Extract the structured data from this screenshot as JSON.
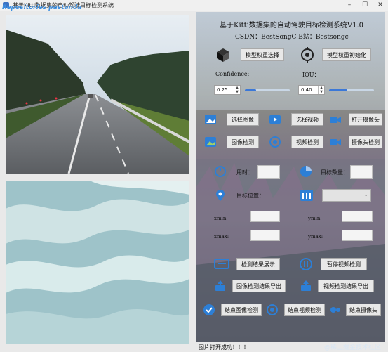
{
  "window": {
    "title": "基于Kitti数据集的自动驾驶目标检测系统",
    "watermark": "Repositories pastanda"
  },
  "header": {
    "title": "基于Kitti数据集的自动驾驶目标检测系统V1.0",
    "credits": "CSDN：BestSongC   B站：Bestsongc"
  },
  "model": {
    "select_weights": "模型权重选择",
    "init_weights": "模型权重初始化"
  },
  "thresholds": {
    "confidence_label": "Confidence:",
    "confidence_value": "0.25",
    "confidence_level": 0.25,
    "iou_label": "IOU：",
    "iou_value": "0.40",
    "iou_level": 0.4
  },
  "inputs": {
    "select_image": "选择图像",
    "select_video": "选择视频",
    "open_camera": "打开摄像头",
    "image_detect": "图像检测",
    "video_detect": "视频检测",
    "camera_detect": "摄像头检测"
  },
  "results": {
    "time_label": "用时：",
    "count_label": "目标数量：",
    "target_pos_label": "目标位置：",
    "xmin_label": "xmin:",
    "ymin_label": "ymin:",
    "xmax_label": "xmax:",
    "ymax_label": "ymax:"
  },
  "actions": {
    "show_results": "检测结果展示",
    "pause_video": "暂停视频检测",
    "export_image": "图像检测结果导出",
    "export_video": "视频检测结果导出",
    "end_image": "结束图像检测",
    "end_video": "结束视频检测",
    "end_camera": "结束摄像头"
  },
  "status": {
    "message": "图片打开成功！！！",
    "watermark": "@稀土掘金技术社区"
  },
  "colors": {
    "accent": "#3b78d8",
    "button_bg": "#e8e8e8"
  }
}
